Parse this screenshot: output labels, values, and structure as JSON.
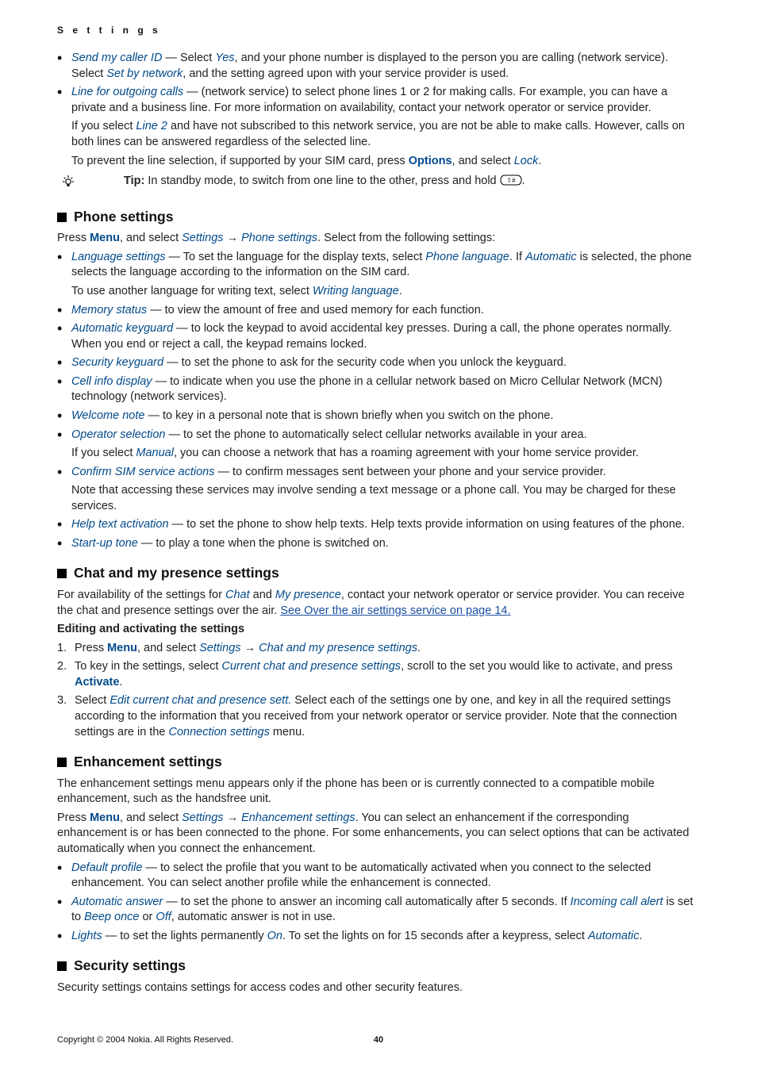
{
  "breadcrumb": "S e t t i n g s",
  "intro_bullets": [
    {
      "pre_em": "Send my caller ID",
      "txt1": " — Select ",
      "em1": "Yes",
      "txt2": ", and your phone number is displayed to the person you are calling (network service). Select ",
      "em2": "Set by network",
      "txt3": ", and the setting agreed upon with your service provider is used."
    },
    {
      "pre_em": "Line for outgoing calls",
      "txt1": " — (network service) to select phone lines 1 or 2 for making calls. For example, you can have a private and a business line. For more information on availability, contact your network operator or service provider."
    }
  ],
  "intro_bullet2_sub1_pre": "If you select ",
  "intro_bullet2_sub1_em": "Line 2",
  "intro_bullet2_sub1_post": " and have not subscribed to this network service, you are not be able to make calls. However, calls on both lines can be answered regardless of the selected line.",
  "intro_bullet2_sub2_pre": "To prevent the line selection, if supported by your SIM card, press ",
  "intro_bullet2_sub2_opt": "Options",
  "intro_bullet2_sub2_mid": ", and select ",
  "intro_bullet2_sub2_em": "Lock",
  "intro_bullet2_sub2_end": ".",
  "tip_label": "Tip:",
  "tip_txt": " In standby mode, to switch from one line to the other, press and hold ",
  "tip_end": ".",
  "phone": {
    "title": "Phone settings",
    "press_pre": "Press ",
    "menu": "Menu",
    "press_mid": ", and select ",
    "settings": "Settings",
    "arrow": " → ",
    "phone_settings": "Phone settings",
    "press_end": ". Select from the following settings:",
    "b1_em": "Language settings",
    "b1_pre": " — To set the language for the display texts, select ",
    "b1_em2": "Phone language",
    "b1_mid": ". If ",
    "b1_em3": "Automatic",
    "b1_end": " is selected, the phone selects the language according to the information on the SIM card.",
    "b1_sub_pre": "To use another language for writing text, select ",
    "b1_sub_em": "Writing language",
    "b1_sub_end": ".",
    "b2_em": "Memory status",
    "b2_txt": " — to view the amount of free and used memory for each function.",
    "b3_em": "Automatic keyguard",
    "b3_txt": " — to lock the keypad to avoid accidental key presses. During a call, the phone operates normally. When you end or reject a call, the keypad remains locked.",
    "b4_em": "Security keyguard",
    "b4_txt": " — to set the phone to ask for the security code when you unlock the keyguard.",
    "b5_em": "Cell info display",
    "b5_txt": " — to indicate when you use the phone in a cellular network based on Micro Cellular Network (MCN) technology (network services).",
    "b6_em": "Welcome note",
    "b6_txt": " — to key in a personal note that is shown briefly when you switch on the phone.",
    "b7_em": "Operator selection",
    "b7_txt": " — to set the phone to automatically select cellular networks available in your area.",
    "b7_sub_pre": "If you select ",
    "b7_sub_em": "Manual",
    "b7_sub_end": ", you can choose a network that has a roaming agreement with your home service provider.",
    "b8_em": "Confirm SIM service actions",
    "b8_txt": " — to confirm messages sent between your phone and your service provider.",
    "b8_sub": "Note that accessing these services may involve sending a text message or a phone call. You may be charged for these services.",
    "b9_em": "Help text activation",
    "b9_txt": " — to set the phone to show help texts. Help texts provide information on using features of the phone.",
    "b10_em": "Start-up tone",
    "b10_txt": " — to play a tone when the phone is switched on."
  },
  "chat": {
    "title": "Chat and my presence settings",
    "p1_pre": "For availability of the settings for ",
    "p1_em1": "Chat",
    "p1_mid": " and ",
    "p1_em2": "My presence",
    "p1_mid2": ", contact your network operator or service provider. You can receive the chat and presence settings over the air. ",
    "p1_link": "See Over the air settings service on page 14.",
    "subhead": "Editing and activating the settings",
    "s1_pre": "Press ",
    "s1_menu": "Menu",
    "s1_mid": ", and select ",
    "s1_settings": "Settings",
    "s1_arrow": " → ",
    "s1_em": "Chat and my presence settings",
    "s1_end": ".",
    "s2_pre": "To key in the settings, select ",
    "s2_em": "Current chat and presence settings",
    "s2_mid": ", scroll to the set you would like to activate, and press ",
    "s2_opt": "Activate",
    "s2_end": ".",
    "s3_pre": "Select ",
    "s3_em": "Edit current chat and presence sett.",
    "s3_mid": " Select each of the settings one by one, and key in all the required settings according to the information that you received from your network operator or service provider. Note that the connection settings are in the ",
    "s3_em2": "Connection settings",
    "s3_end": " menu."
  },
  "enh": {
    "title": "Enhancement settings",
    "p1": "The enhancement settings menu appears only if the phone has been or is currently connected to a compatible mobile enhancement, such as the handsfree unit.",
    "p2_pre": "Press ",
    "p2_menu": "Menu",
    "p2_mid": ", and select ",
    "p2_settings": "Settings",
    "p2_arrow": " → ",
    "p2_em": "Enhancement settings",
    "p2_end": ". You can select an enhancement if the corresponding enhancement is or has been connected to the phone. For some enhancements, you can select options that can be activated automatically when you connect the enhancement.",
    "b1_em": "Default profile",
    "b1_txt": " — to select the profile that you want to be automatically activated when you connect to the selected enhancement. You can select another profile while the enhancement is connected.",
    "b2_em": "Automatic answer",
    "b2_pre": " — to set the phone to answer an incoming call automatically after 5 seconds. If ",
    "b2_em2": "Incoming call alert",
    "b2_mid": " is set to ",
    "b2_em3": "Beep once",
    "b2_mid2": " or ",
    "b2_em4": "Off",
    "b2_end": ", automatic answer is not in use.",
    "b3_em": "Lights",
    "b3_pre": " — to set the lights permanently ",
    "b3_em2": "On",
    "b3_mid": ". To set the lights on for 15 seconds after a keypress, select ",
    "b3_em3": "Automatic",
    "b3_end": "."
  },
  "sec": {
    "title": "Security settings",
    "p1": "Security settings contains settings for access codes and other security features."
  },
  "footer": {
    "copyright": "Copyright © 2004 Nokia. All Rights Reserved.",
    "page": "40"
  }
}
